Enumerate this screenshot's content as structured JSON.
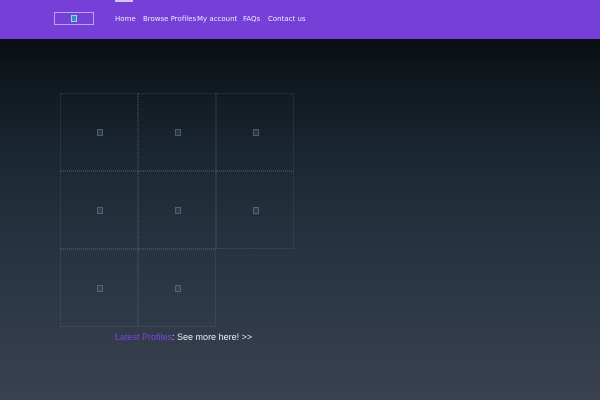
{
  "header": {
    "nav": [
      {
        "label": "Home",
        "active": true
      },
      {
        "label": "Browse Profiles",
        "active": false
      },
      {
        "label": "My account",
        "active": false
      },
      {
        "label": "FAQs",
        "active": false
      },
      {
        "label": "Contact us",
        "active": false
      }
    ]
  },
  "profiles_grid": {
    "cells": 8,
    "thumbnail_icon": "broken-image-icon"
  },
  "latest": {
    "label": "Latest Profiles",
    "link": "See more here! >>"
  },
  "colors": {
    "accent": "#7640d8",
    "label": "#7a45e0"
  }
}
